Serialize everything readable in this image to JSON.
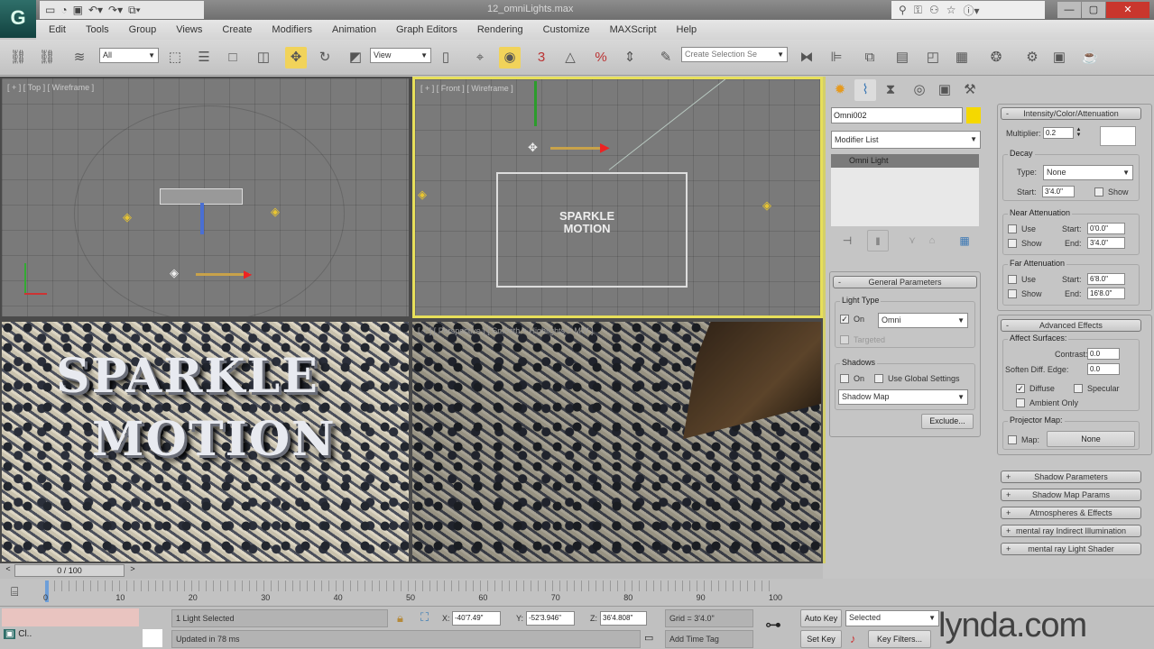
{
  "title_bar": {
    "app_logo": "3ds Max",
    "document": "12_omniLights.max",
    "quick_access": [
      "new-icon",
      "open-icon",
      "save-icon",
      "undo-icon",
      "redo-icon",
      "project-icon"
    ],
    "info_center": [
      "binoculars-icon",
      "key-icon",
      "subscription-icon",
      "favorites-icon",
      "help-icon"
    ],
    "window_buttons": [
      "—",
      "▢",
      "✕"
    ]
  },
  "menu": [
    "Edit",
    "Tools",
    "Group",
    "Views",
    "Create",
    "Modifiers",
    "Animation",
    "Graph Editors",
    "Rendering",
    "Customize",
    "MAXScript",
    "Help"
  ],
  "toolbar": {
    "selection_filter": "All",
    "ref_coord": "View",
    "named_selection": "Create Selection Se",
    "snap_label": "3"
  },
  "viewports": {
    "top": {
      "label": "[ + ] [ Top ] [ Wireframe ]"
    },
    "front": {
      "label": "[ + ] [ Front ] [ Wireframe ]"
    },
    "camera": {
      "line1": "SPARKLE",
      "line2": "MOTION"
    },
    "perspective": {
      "label": "[ + ] [ Perspective ] [ Smooth + Highlights + MW ]"
    }
  },
  "command_panel": {
    "tabs": [
      "create-icon",
      "modify-icon",
      "hierarchy-icon",
      "motion-icon",
      "display-icon",
      "utilities-icon"
    ],
    "object_name": "Omni002",
    "object_color": "#f5d800",
    "modifier_list": "Modifier List",
    "stack_item": "Omni Light",
    "general": {
      "header": "General Parameters",
      "light_type_group": "Light Type",
      "on_label": "On",
      "on_checked": true,
      "type": "Omni",
      "targeted": "Targeted",
      "shadows_group": "Shadows",
      "shadows_on": "On",
      "use_global": "Use Global Settings",
      "shadow_type": "Shadow Map",
      "exclude": "Exclude..."
    },
    "intensity": {
      "header": "Intensity/Color/Attenuation",
      "multiplier_label": "Multiplier:",
      "multiplier": "0.2",
      "decay_group": "Decay",
      "type_label": "Type:",
      "decay_type": "None",
      "start_label": "Start:",
      "decay_start": "3'4.0\"",
      "show_label": "Show",
      "near_group": "Near Attenuation",
      "use_label": "Use",
      "end_label": "End:",
      "near_start": "0'0.0\"",
      "near_end": "3'4.0\"",
      "far_group": "Far Attenuation",
      "far_start": "6'8.0\"",
      "far_end": "16'8.0\""
    },
    "advanced": {
      "header": "Advanced Effects",
      "affect_group": "Affect Surfaces:",
      "contrast_label": "Contrast:",
      "contrast": "0.0",
      "soften_label": "Soften Diff. Edge:",
      "soften": "0.0",
      "diffuse": "Diffuse",
      "specular": "Specular",
      "ambient_only": "Ambient Only",
      "projector_group": "Projector Map:",
      "map_label": "Map:",
      "map_value": "None"
    },
    "collapsed": [
      "Shadow Parameters",
      "Shadow Map Params",
      "Atmospheres & Effects",
      "mental ray Indirect Illumination",
      "mental ray Light Shader"
    ]
  },
  "timeline": {
    "frame": "0 / 100",
    "prev": "<",
    "next": ">",
    "ticks": [
      "0",
      "10",
      "20",
      "30",
      "40",
      "50",
      "60",
      "70",
      "80",
      "90",
      "100"
    ],
    "progress": 0
  },
  "status": {
    "maxscript": "Cl..",
    "selection": "1 Light Selected",
    "prompt": "Updated in 78 ms",
    "x_label": "X:",
    "x": "-40'7.49\"",
    "y_label": "Y:",
    "y": "-52'3.946\"",
    "z_label": "Z:",
    "z": "36'4.808\"",
    "grid": "Grid = 3'4.0\"",
    "add_time_tag": "Add Time Tag",
    "auto_key": "Auto Key",
    "set_key": "Set Key",
    "key_mode": "Selected",
    "key_filters": "Key Filters...",
    "watermark": "lynda.com"
  }
}
